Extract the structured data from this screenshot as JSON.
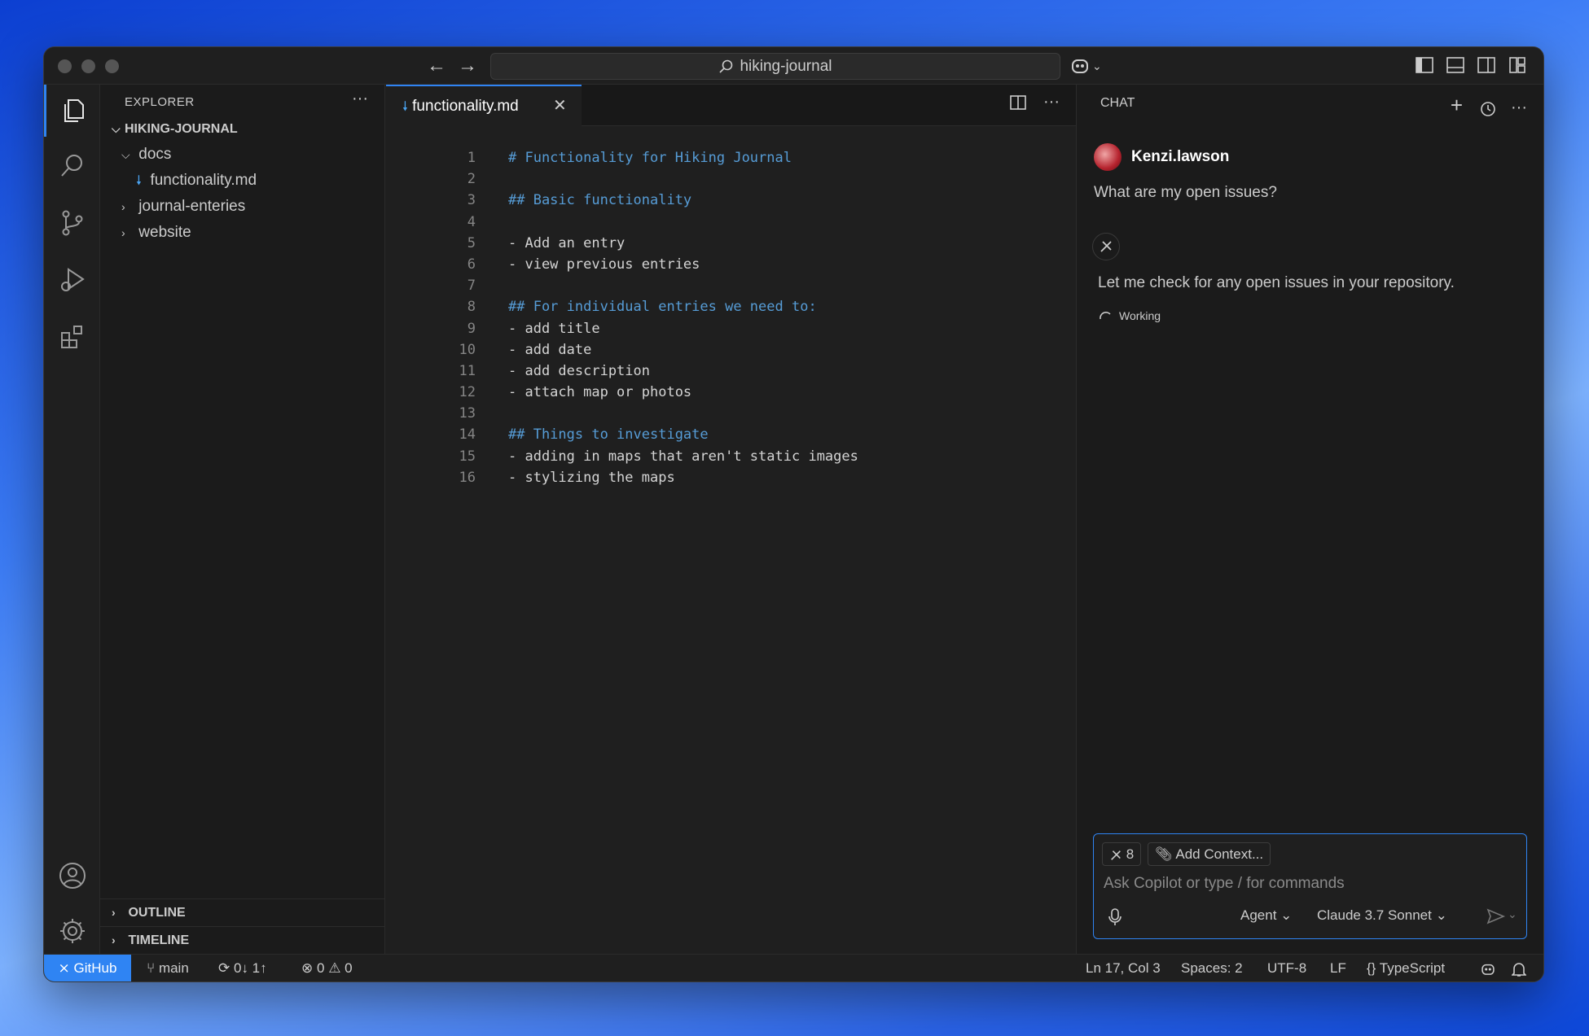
{
  "titlebar": {
    "search_text": "hiking-journal"
  },
  "sidebar": {
    "title": "EXPLORER",
    "more": "···",
    "root": "HIKING-JOURNAL",
    "items": [
      {
        "label": "docs"
      },
      {
        "label": "functionality.md"
      },
      {
        "label": "journal-enteries"
      },
      {
        "label": "website"
      }
    ],
    "outline": "OUTLINE",
    "timeline": "TIMELINE"
  },
  "editor": {
    "tab_label": "functionality.md",
    "lines": [
      {
        "n": "1",
        "text": "# Functionality for Hiking Journal"
      },
      {
        "n": "2",
        "text": ""
      },
      {
        "n": "3",
        "text": "## Basic functionality"
      },
      {
        "n": "4",
        "text": ""
      },
      {
        "n": "5",
        "text": "- Add an entry"
      },
      {
        "n": "6",
        "text": "- view previous entries"
      },
      {
        "n": "7",
        "text": ""
      },
      {
        "n": "8",
        "text": "## For individual entries we need to:"
      },
      {
        "n": "9",
        "text": "- add title"
      },
      {
        "n": "10",
        "text": "- add date"
      },
      {
        "n": "11",
        "text": "- add description"
      },
      {
        "n": "12",
        "text": "- attach map or photos"
      },
      {
        "n": "13",
        "text": ""
      },
      {
        "n": "14",
        "text": "## Things to investigate"
      },
      {
        "n": "15",
        "text": "- adding in maps that aren't static images"
      },
      {
        "n": "16",
        "text": "- stylizing the maps"
      }
    ]
  },
  "chat": {
    "title": "CHAT",
    "user_name": "Kenzi.lawson",
    "user_message": "What are my open issues?",
    "reply": "Let me check for any open issues in your repository.",
    "status": "Working",
    "tools_count": "8",
    "add_context": "Add Context...",
    "placeholder": "Ask Copilot or type / for commands",
    "mode": "Agent",
    "model": "Claude 3.7 Sonnet"
  },
  "statusbar": {
    "remote": "GitHub",
    "branch": "main",
    "sync": "0↓ 1↑",
    "errors": "0",
    "warnings": "0",
    "position": "Ln 17, Col 3",
    "spaces": "Spaces: 2",
    "encoding": "UTF-8",
    "eol": "LF",
    "language": "TypeScript"
  },
  "colors": {
    "accent": "#2f84f3",
    "heading": "#569cd6"
  }
}
